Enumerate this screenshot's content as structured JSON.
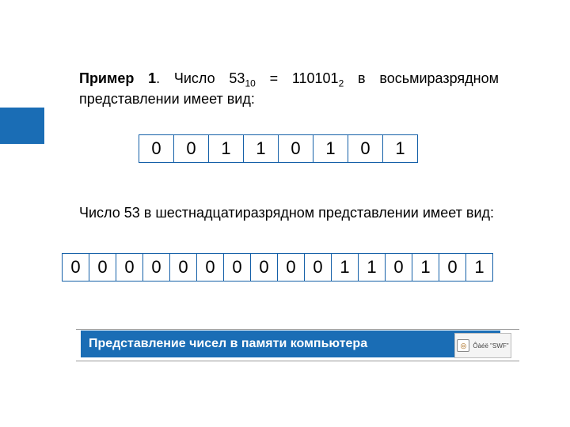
{
  "paragraph1": {
    "bold_prefix": "Пример 1",
    "after_bold": ". Число 53",
    "sub1": "10",
    "mid": " = 110101",
    "sub2": "2",
    "tail": " в восьмиразрядном представлении имеет вид:"
  },
  "row8": [
    "0",
    "0",
    "1",
    "1",
    "0",
    "1",
    "0",
    "1"
  ],
  "paragraph2": "Число 53 в шестнадцатиразрядном представлении имеет вид:",
  "row16": [
    "0",
    "0",
    "0",
    "0",
    "0",
    "0",
    "0",
    "0",
    "0",
    "0",
    "1",
    "1",
    "0",
    "1",
    "0",
    "1"
  ],
  "footer": {
    "title": "Представление чисел в памяти компьютера",
    "swf_label": "Ôàéë \"SWF\""
  },
  "colors": {
    "accent": "#1a6db5",
    "cell_border": "#1560a8"
  }
}
